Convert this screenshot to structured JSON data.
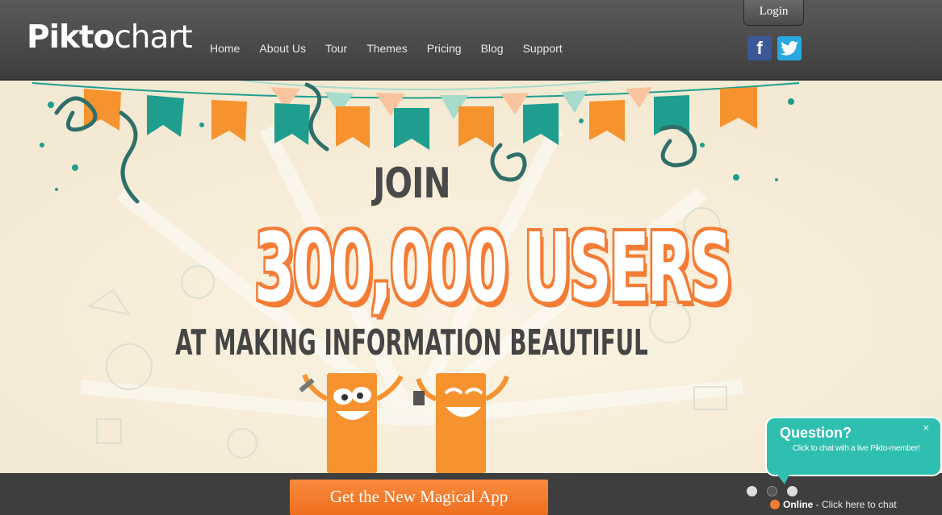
{
  "header": {
    "logo": {
      "bold": "Pikto",
      "light": "chart"
    },
    "nav": [
      "Home",
      "About Us",
      "Tour",
      "Themes",
      "Pricing",
      "Blog",
      "Support"
    ],
    "login": "Login",
    "social": {
      "facebook": "f",
      "twitter": "t"
    }
  },
  "hero": {
    "join": "JOIN",
    "headline": "300,000 USERS",
    "tagline": "AT MAKING INFORMATION BEAUTIFUL",
    "colors": {
      "orange": "#f47c35",
      "teal": "#1f9e8f",
      "mint": "#a7dccc",
      "bg": "#f7eedc"
    }
  },
  "cta": "Get the New Magical App",
  "slider": {
    "count": 3,
    "active_index": 1
  },
  "chat": {
    "title": "Question?",
    "subtitle": "Click to chat with a live Pikto-member!",
    "close": "×",
    "status": "Online",
    "status_rest": " - Click here to chat"
  }
}
